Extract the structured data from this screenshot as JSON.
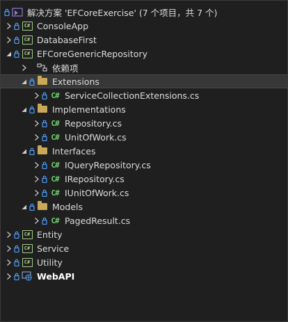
{
  "solution": {
    "title": "解决方案 'EFCoreExercise' (7 个项目，共 7 个)"
  },
  "projects": {
    "console_app": "ConsoleApp",
    "database_first": "DatabaseFirst",
    "generic_repo": "EFCoreGenericRepository",
    "entity": "Entity",
    "service": "Service",
    "utility": "Utility",
    "webapi": "WebAPI"
  },
  "repo": {
    "dependencies": "依赖项",
    "extensions": {
      "label": "Extensions",
      "files": [
        "ServiceCollectionExtensions.cs"
      ]
    },
    "implementations": {
      "label": "Implementations",
      "files": [
        "Repository.cs",
        "UnitOfWork.cs"
      ]
    },
    "interfaces": {
      "label": "Interfaces",
      "files": [
        "IQueryRepository.cs",
        "IRepository.cs",
        "IUnitOfWork.cs"
      ]
    },
    "models": {
      "label": "Models",
      "files": [
        "PagedResult.cs"
      ]
    }
  },
  "icons": {
    "csharp_file": "C#",
    "csharp_project": "C#"
  },
  "colors": {
    "background": "#1f1f1f",
    "selection": "#373737",
    "folder": "#c8a95a",
    "csharp": "#6fcf6f",
    "lock": "#4ea1ff"
  }
}
